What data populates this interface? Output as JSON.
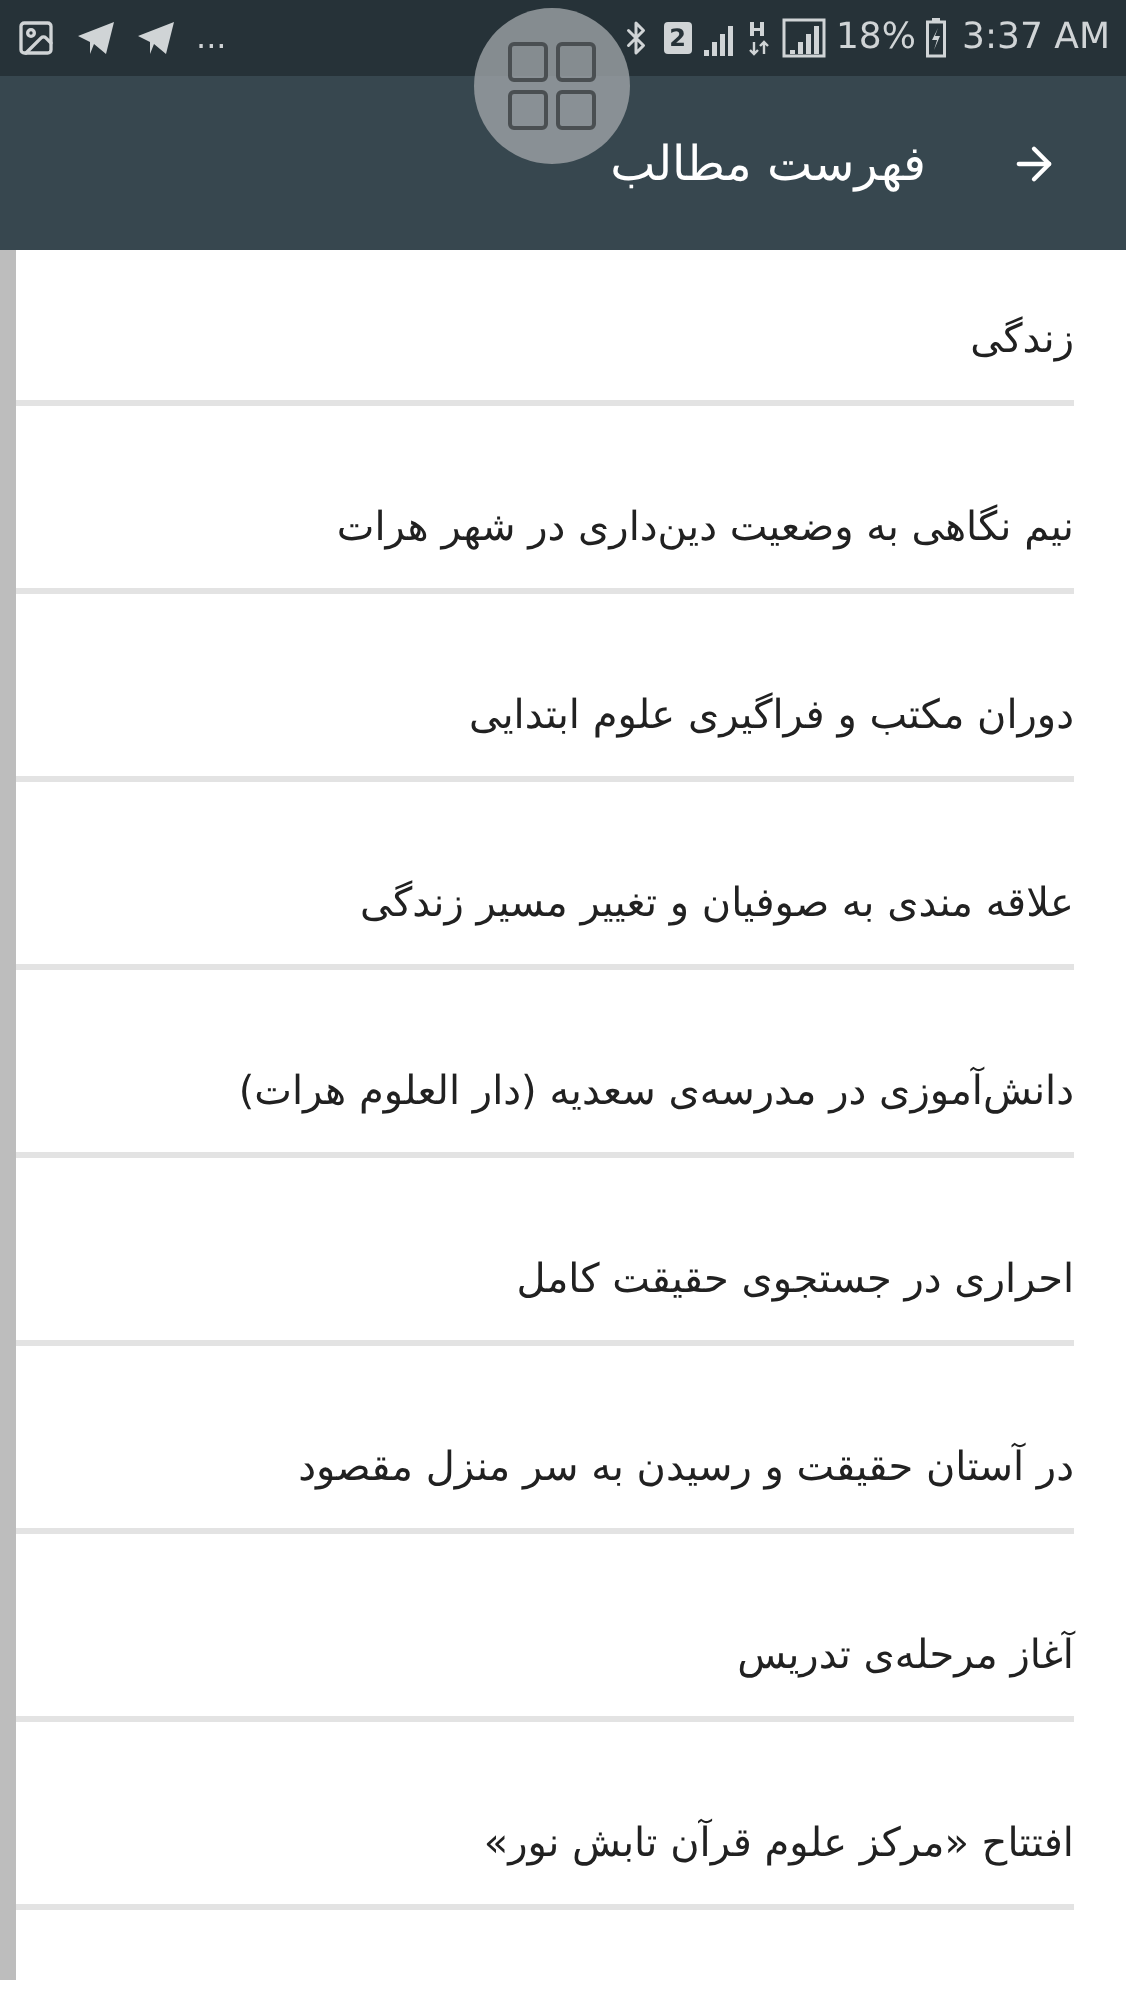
{
  "status_bar": {
    "overflow": "...",
    "sim_label": "2",
    "battery": "18%",
    "time": "3:37 AM"
  },
  "header": {
    "title": "فهرست مطالب"
  },
  "items": [
    {
      "label": "زندگی"
    },
    {
      "label": "نیم نگاهی به وضعیت دین‌داری در شهر هرات"
    },
    {
      "label": "دوران مکتب و فراگیری علوم ابتدایی"
    },
    {
      "label": "علاقه مندی به صوفیان و تغییر مسیر زندگی"
    },
    {
      "label": "دانش‌آموزی در مدرسه‌ی سعدیه (دار العلوم هرات)"
    },
    {
      "label": "احراری در جستجوی حقیقت کامل"
    },
    {
      "label": "در آستان حقیقت و رسیدن به سر منزل مقصود"
    },
    {
      "label": "آغاز مرحله‌ی تدریس"
    },
    {
      "label": "افتتاح «مرکز علوم قرآن تابش نور»"
    }
  ]
}
